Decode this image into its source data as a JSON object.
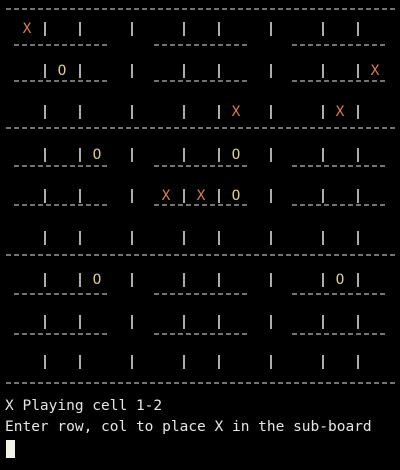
{
  "terminal": {
    "board_lines": [
      "--------------------------------------------------",
      " X|  |  |  |  |  |  |  |  |",
      "-----------  -----------  -----------",
      "  |O|  |  |  |  |  |  |X|",
      "-----------  -----------  -----------",
      "  |  |  |  |  |X |  |X|  |",
      "--------------------------------------------------",
      "  |  |O|  |  |O|  |  |  |",
      "-----------  -----------  -----------",
      "  |  |  |  X|X|O|  |  |  |",
      "-----------  -----------  -----------",
      "  |  |  |  |  |  |  |  |  |",
      "--------------------------------------------------",
      "  |  |O|  |  |  |  |O|  |",
      "-----------  -----------  -----------",
      "  |  |  |  |  |  |  |  |  |",
      "-----------  -----------  -----------",
      "  |  |  |  |  |  |  |  |  |",
      "--------------------------------------------------"
    ],
    "status_line": "X Playing cell 1-2",
    "prompt_line": "Enter row, col to place X in the sub-board",
    "colors": {
      "background": "#000000",
      "text": "#e6e6e6",
      "x_mark": "#e07a4a",
      "o_mark": "#d9cc8a",
      "cursor": "#f2f2ec"
    }
  }
}
